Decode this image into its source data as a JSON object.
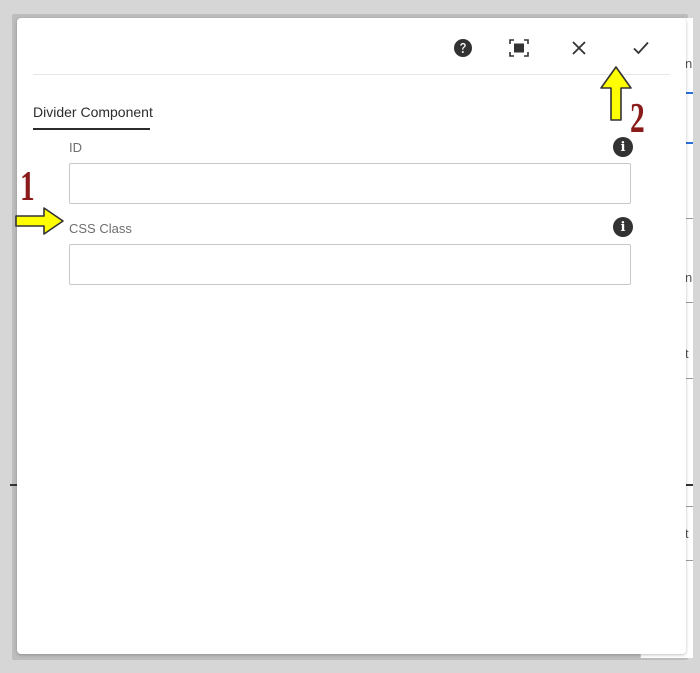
{
  "toolbar": {
    "help_icon": "help-circle-icon",
    "fullscreen_icon": "fullscreen-icon",
    "close_icon": "close-icon",
    "done_icon": "checkmark-icon"
  },
  "tabs": [
    {
      "label": "Divider Component",
      "active": true
    }
  ],
  "fields": [
    {
      "label": "ID",
      "value": "",
      "placeholder": ""
    },
    {
      "label": "CSS Class",
      "value": "",
      "placeholder": ""
    }
  ],
  "annotations": {
    "marker_1": "1",
    "marker_2": "2"
  },
  "colors": {
    "arrow_fill": "#ffff00",
    "annotation_number": "#8b1a1a",
    "icon_dark": "#323232",
    "accent_blue": "#2a6fd6"
  }
}
